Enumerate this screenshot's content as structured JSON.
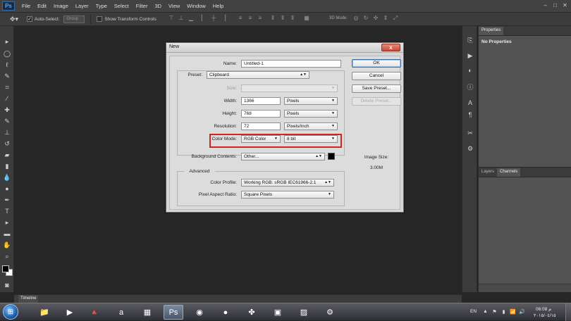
{
  "app": {
    "logo": "Ps"
  },
  "menu": [
    "File",
    "Edit",
    "Image",
    "Layer",
    "Type",
    "Select",
    "Filter",
    "3D",
    "View",
    "Window",
    "Help"
  ],
  "window_controls": {
    "minimize": "–",
    "restore": "□",
    "close": "✕"
  },
  "options_bar": {
    "auto_select_label": "Auto-Select:",
    "auto_select_checked": true,
    "group_value": "Group",
    "show_transform_label": "Show Transform Controls",
    "show_transform_checked": false,
    "three_d_mode_label": "3D Mode:"
  },
  "panels": {
    "properties_tab": "Properties",
    "properties_message": "No Properties",
    "layers_tab": "Layers",
    "channels_tab": "Channels",
    "timeline_tab": "Timeline"
  },
  "dialog": {
    "title": "New",
    "close_glyph": "x",
    "name_label": "Name:",
    "name_value": "Untitled-1",
    "preset_label": "Preset:",
    "preset_value": "Clipboard",
    "size_label": "Size:",
    "size_value": "",
    "width_label": "Width:",
    "width_value": "1366",
    "width_unit": "Pixels",
    "height_label": "Height:",
    "height_value": "768",
    "height_unit": "Pixels",
    "resolution_label": "Resolution:",
    "resolution_value": "72",
    "resolution_unit": "Pixels/Inch",
    "color_mode_label": "Color Mode:",
    "color_mode_value": "RGB Color",
    "bit_depth_value": "8 bit",
    "bg_contents_label": "Background Contents:",
    "bg_contents_value": "Other...",
    "bg_swatch_color": "#000000",
    "advanced_label": "Advanced",
    "color_profile_label": "Color Profile:",
    "color_profile_value": "Working RGB:  sRGB IEC61966-2.1",
    "pixel_aspect_label": "Pixel Aspect Ratio:",
    "pixel_aspect_value": "Square Pixels",
    "ok_label": "OK",
    "cancel_label": "Cancel",
    "save_preset_label": "Save Preset...",
    "delete_preset_label": "Delete Preset...",
    "image_size_label": "Image Size:",
    "image_size_value": "3.00M",
    "highlight_color": "#d32222"
  },
  "taskbar": {
    "start_glyph": "⊞",
    "language": "EN",
    "time": "06:08 م",
    "date": "٢٠١٥/٠٤/١٥"
  }
}
